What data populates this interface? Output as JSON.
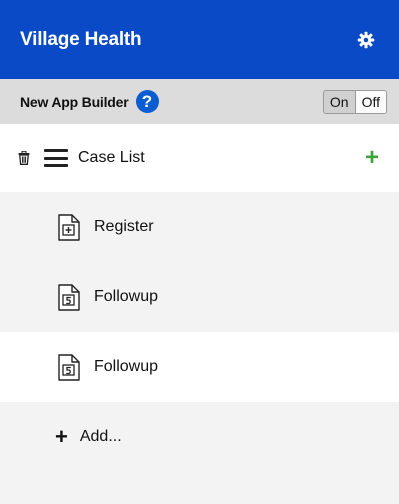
{
  "header": {
    "title": "Village Health",
    "settings_icon": "gear-icon"
  },
  "builder": {
    "label": "New App Builder",
    "help_icon": "question-circle-icon",
    "help_symbol": "?",
    "toggle": {
      "on_label": "On",
      "off_label": "Off",
      "selected": "On"
    }
  },
  "module": {
    "name": "Case List",
    "delete_icon": "trash-icon",
    "drag_icon": "menu-icon",
    "add_icon": "plus-icon",
    "add_symbol": "+",
    "forms": [
      {
        "label": "Register",
        "icon": "form-register-icon"
      },
      {
        "label": "Followup",
        "icon": "form-followup-icon"
      },
      {
        "label": "Followup",
        "icon": "form-followup-icon"
      }
    ]
  },
  "add": {
    "symbol": "+",
    "label": "Add..."
  },
  "colors": {
    "header_bg": "#0a4ac7",
    "help_bg": "#0a5cd1",
    "add_green": "#3aa63a"
  }
}
